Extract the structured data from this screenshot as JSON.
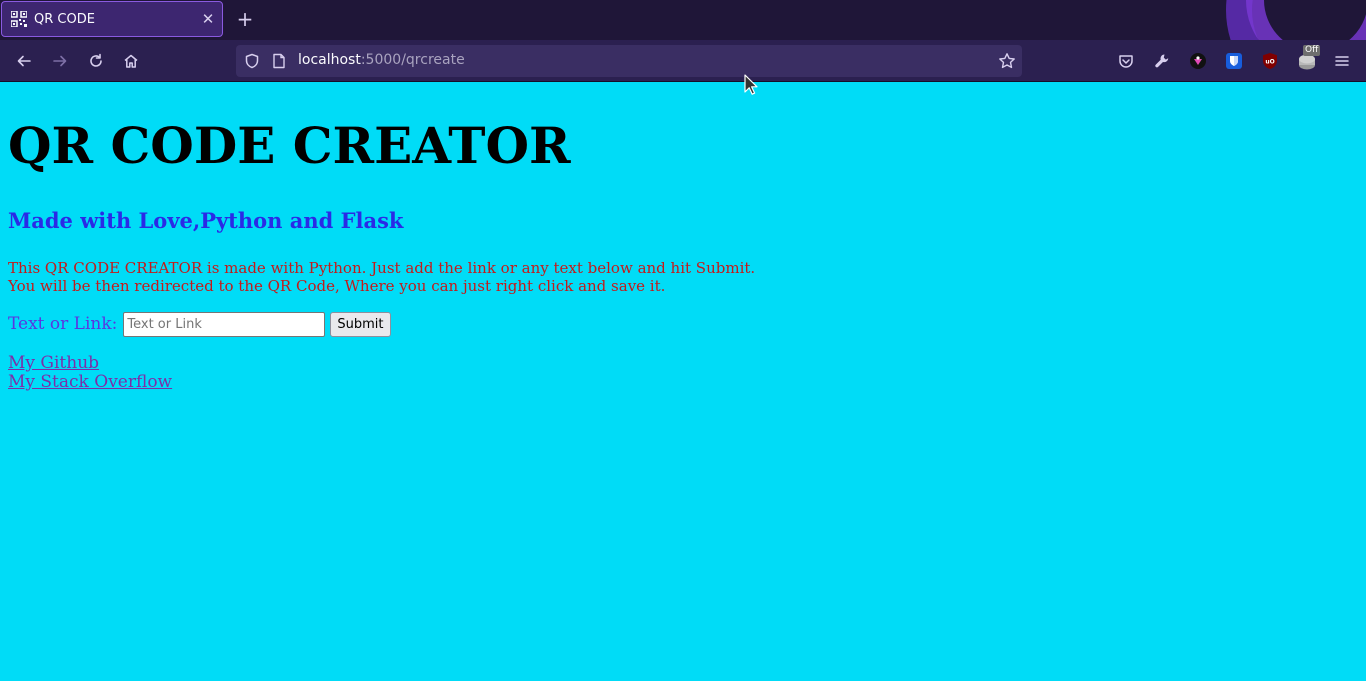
{
  "browser": {
    "tab": {
      "title": "QR CODE",
      "close_glyph": "✕"
    },
    "new_tab_glyph": "+",
    "url": {
      "host": "localhost",
      "path": ":5000/qrcreate"
    },
    "extensions": {
      "off_badge": "Off"
    },
    "colors": {
      "tabbar_bg": "#1f1638",
      "navbar_bg": "#2b2050",
      "urlbar_bg": "#3a2e63",
      "icon_color": "#d8cfee"
    }
  },
  "page": {
    "background": "#00dcf7",
    "heading": "QR CODE CREATOR",
    "subheading": "Made with Love,Python and Flask",
    "description_line1": "This QR CODE CREATOR is made with Python. Just add the link or any text below and hit Submit.",
    "description_line2": "You will be then redirected to the QR Code, Where you can just right click and save it.",
    "form": {
      "label": "Text or Link:",
      "input_placeholder": "Text or Link",
      "input_value": "",
      "submit_label": "Submit"
    },
    "links": [
      {
        "label": "My Github"
      },
      {
        "label": "My Stack Overflow"
      }
    ],
    "colors": {
      "heading": "#000000",
      "subheading": "#2a2ae6",
      "description": "#c41a1a",
      "label": "#5a36e0",
      "link": "#7b2fa8"
    }
  }
}
